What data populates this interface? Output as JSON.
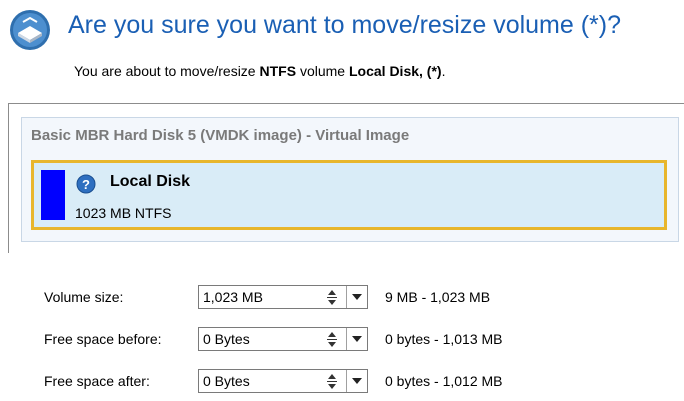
{
  "header": {
    "title": "Are you sure you want to move/resize volume (*)?",
    "subtitle_prefix": "You are about to move/resize ",
    "subtitle_fs": "NTFS",
    "subtitle_mid": " volume ",
    "subtitle_vol": "Local Disk, (*)",
    "subtitle_suffix": ".",
    "icon": "disk-resize-icon"
  },
  "disk": {
    "title": "Basic MBR Hard Disk 5 (VMDK image) - Virtual Image",
    "volume_name": "Local Disk",
    "volume_size": "1023 MB NTFS",
    "volume_icon": "help-icon",
    "volume_color": "#0000ff",
    "selected_border_color": "#e8b62c"
  },
  "fields": {
    "volume_size": {
      "label": "Volume size:",
      "value": "1,023 MB",
      "range": "9 MB - 1,023 MB"
    },
    "free_before": {
      "label": "Free space before:",
      "value": "0 Bytes",
      "range": "0 bytes - 1,013 MB"
    },
    "free_after": {
      "label": "Free space after:",
      "value": "0 Bytes",
      "range": "0 bytes - 1,012 MB"
    }
  }
}
